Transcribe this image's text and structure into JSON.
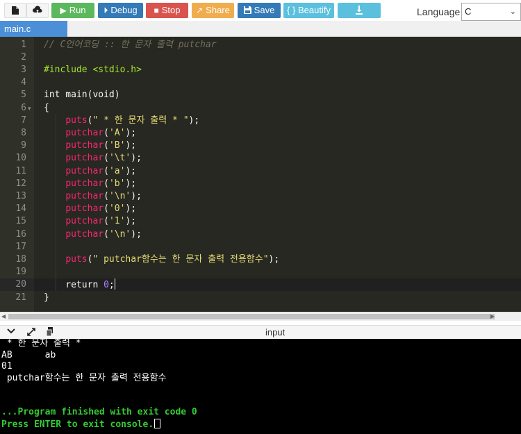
{
  "toolbar": {
    "new_icon": "new-file-icon",
    "open_icon": "upload-icon",
    "run_label": "Run",
    "debug_label": "Debug",
    "stop_label": "Stop",
    "share_label": "Share",
    "save_label": "Save",
    "beautify_label": "{ } Beautify",
    "download_icon": "download-icon",
    "language_label": "Language",
    "language_value": "C"
  },
  "tabs": [
    {
      "label": "main.c"
    }
  ],
  "editor": {
    "active_line": 20,
    "lines": [
      {
        "n": "1",
        "tokens": [
          {
            "t": "// C언어코딩 :: 한 문자 출력 putchar",
            "c": "com"
          }
        ]
      },
      {
        "n": "2",
        "tokens": []
      },
      {
        "n": "3",
        "tokens": [
          {
            "t": "#include ",
            "c": "pre"
          },
          {
            "t": "<stdio.h>",
            "c": "inc"
          }
        ]
      },
      {
        "n": "4",
        "tokens": []
      },
      {
        "n": "5",
        "tokens": [
          {
            "t": "int main(void)",
            "c": "kw"
          }
        ]
      },
      {
        "n": "6",
        "fold": true,
        "tokens": [
          {
            "t": "{",
            "c": "kw"
          }
        ]
      },
      {
        "n": "7",
        "tokens": [
          {
            "t": "    ",
            "c": "kw"
          },
          {
            "t": "puts",
            "c": "fn"
          },
          {
            "t": "(",
            "c": "kw"
          },
          {
            "t": "\" * 한 문자 출력 * \"",
            "c": "str"
          },
          {
            "t": ");",
            "c": "kw"
          }
        ]
      },
      {
        "n": "8",
        "tokens": [
          {
            "t": "    ",
            "c": "kw"
          },
          {
            "t": "putchar",
            "c": "fn"
          },
          {
            "t": "(",
            "c": "kw"
          },
          {
            "t": "'A'",
            "c": "str"
          },
          {
            "t": ");",
            "c": "kw"
          }
        ]
      },
      {
        "n": "9",
        "tokens": [
          {
            "t": "    ",
            "c": "kw"
          },
          {
            "t": "putchar",
            "c": "fn"
          },
          {
            "t": "(",
            "c": "kw"
          },
          {
            "t": "'B'",
            "c": "str"
          },
          {
            "t": ");",
            "c": "kw"
          }
        ]
      },
      {
        "n": "10",
        "tokens": [
          {
            "t": "    ",
            "c": "kw"
          },
          {
            "t": "putchar",
            "c": "fn"
          },
          {
            "t": "(",
            "c": "kw"
          },
          {
            "t": "'\\t'",
            "c": "str"
          },
          {
            "t": ");",
            "c": "kw"
          }
        ]
      },
      {
        "n": "11",
        "tokens": [
          {
            "t": "    ",
            "c": "kw"
          },
          {
            "t": "putchar",
            "c": "fn"
          },
          {
            "t": "(",
            "c": "kw"
          },
          {
            "t": "'a'",
            "c": "str"
          },
          {
            "t": ");",
            "c": "kw"
          }
        ]
      },
      {
        "n": "12",
        "tokens": [
          {
            "t": "    ",
            "c": "kw"
          },
          {
            "t": "putchar",
            "c": "fn"
          },
          {
            "t": "(",
            "c": "kw"
          },
          {
            "t": "'b'",
            "c": "str"
          },
          {
            "t": ");",
            "c": "kw"
          }
        ]
      },
      {
        "n": "13",
        "tokens": [
          {
            "t": "    ",
            "c": "kw"
          },
          {
            "t": "putchar",
            "c": "fn"
          },
          {
            "t": "(",
            "c": "kw"
          },
          {
            "t": "'\\n'",
            "c": "str"
          },
          {
            "t": ");",
            "c": "kw"
          }
        ]
      },
      {
        "n": "14",
        "tokens": [
          {
            "t": "    ",
            "c": "kw"
          },
          {
            "t": "putchar",
            "c": "fn"
          },
          {
            "t": "(",
            "c": "kw"
          },
          {
            "t": "'0'",
            "c": "str"
          },
          {
            "t": ");",
            "c": "kw"
          }
        ]
      },
      {
        "n": "15",
        "tokens": [
          {
            "t": "    ",
            "c": "kw"
          },
          {
            "t": "putchar",
            "c": "fn"
          },
          {
            "t": "(",
            "c": "kw"
          },
          {
            "t": "'1'",
            "c": "str"
          },
          {
            "t": ");",
            "c": "kw"
          }
        ]
      },
      {
        "n": "16",
        "tokens": [
          {
            "t": "    ",
            "c": "kw"
          },
          {
            "t": "putchar",
            "c": "fn"
          },
          {
            "t": "(",
            "c": "kw"
          },
          {
            "t": "'\\n'",
            "c": "str"
          },
          {
            "t": ");",
            "c": "kw"
          }
        ]
      },
      {
        "n": "17",
        "tokens": []
      },
      {
        "n": "18",
        "tokens": [
          {
            "t": "    ",
            "c": "kw"
          },
          {
            "t": "puts",
            "c": "fn"
          },
          {
            "t": "(",
            "c": "kw"
          },
          {
            "t": "\" putchar함수는 한 문자 출력 전용함수\"",
            "c": "str"
          },
          {
            "t": ");",
            "c": "kw"
          }
        ]
      },
      {
        "n": "19",
        "tokens": []
      },
      {
        "n": "20",
        "tokens": [
          {
            "t": "    return ",
            "c": "kw"
          },
          {
            "t": "0",
            "c": "num"
          },
          {
            "t": ";",
            "c": "kw"
          }
        ]
      },
      {
        "n": "21",
        "tokens": [
          {
            "t": "}",
            "c": "kw"
          }
        ]
      }
    ]
  },
  "io": {
    "title": "input",
    "icons": [
      "chevron-down-icon",
      "expand-icon",
      "copy-icon"
    ]
  },
  "console": {
    "lines": [
      {
        "text": " * 한 문자 출력 *",
        "style": "normal"
      },
      {
        "text": "AB      ab",
        "style": "normal"
      },
      {
        "text": "01",
        "style": "normal"
      },
      {
        "text": " putchar함수는 한 문자 출력 전용함수",
        "style": "normal"
      },
      {
        "text": "",
        "style": "normal"
      },
      {
        "text": "",
        "style": "normal"
      },
      {
        "text": "...Program finished with exit code 0",
        "style": "green"
      },
      {
        "text": "Press ENTER to exit console.",
        "style": "green",
        "cursor": true
      }
    ]
  },
  "colors": {
    "run": "#5cb85c",
    "debug": "#337ab7",
    "stop": "#d9534f",
    "share": "#f0ad4e",
    "save": "#337ab7",
    "beautify": "#5bc0de",
    "tab": "#4b8fd8",
    "editor_bg": "#272822",
    "console_bg": "#000000",
    "console_green": "#33cc33"
  }
}
